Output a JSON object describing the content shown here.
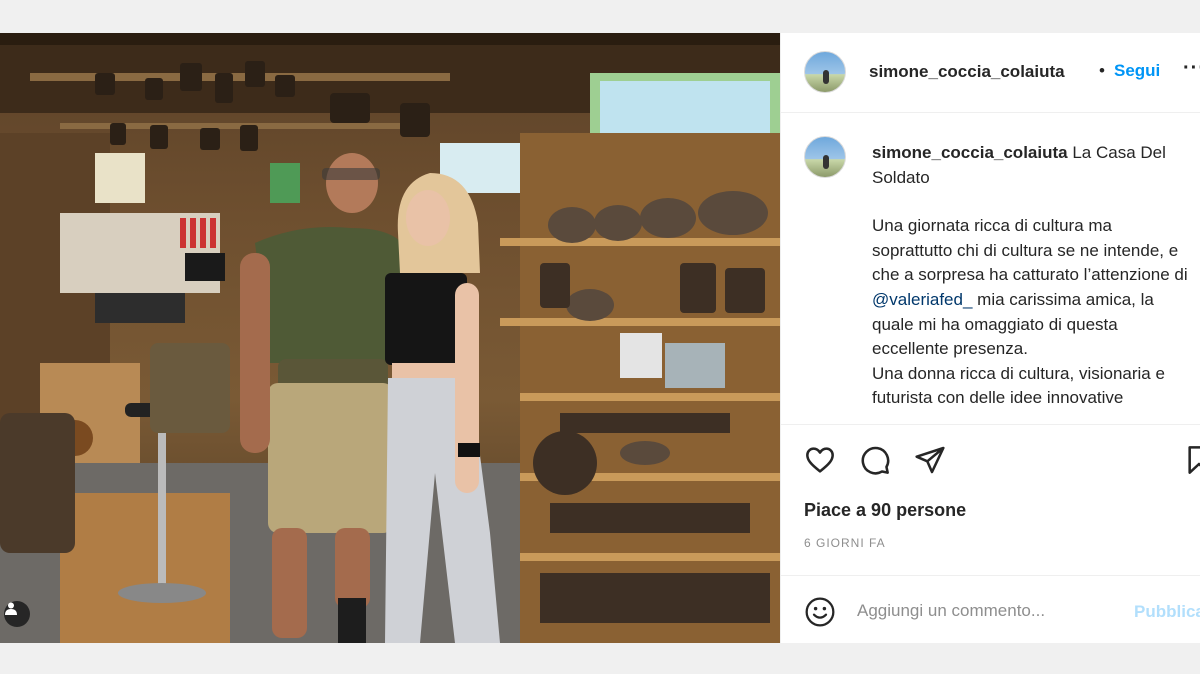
{
  "post": {
    "photo_description_icon": "user-tag-icon"
  },
  "header": {
    "username": "simone_coccia_colaiuta",
    "separator": "•",
    "follow_label": "Segui",
    "more_label": "···"
  },
  "caption": {
    "username": "simone_coccia_colaiuta",
    "title": "La Casa Del Soldato",
    "paragraph_before_mention": "Una giornata ricca di cultura ma soprattutto chi di cultura se ne intende, e che a sorpresa ha catturato l’attenzione di",
    "mention": "@valeriafed_",
    "paragraph_after_mention": "mia carissima amica, la quale mi ha omaggiato di questa eccellente presenza.",
    "paragraph_2": "Una donna ricca di cultura, visionaria e futurista con delle idee innovative"
  },
  "actions": {
    "like_icon": "heart-icon",
    "comment_icon": "comment-icon",
    "share_icon": "send-icon",
    "save_icon": "bookmark-icon"
  },
  "likes_text": "Piace a 90 persone",
  "date_text": "6 GIORNI FA",
  "comment": {
    "emoji_icon": "emoji-icon",
    "placeholder": "Aggiungi un commento...",
    "publish_label": "Pubblica"
  },
  "colors": {
    "accent": "#0095f6",
    "publish_disabled": "#b2dffc",
    "mention": "#00376b",
    "muted": "#8e8e8e",
    "text": "#262626"
  }
}
